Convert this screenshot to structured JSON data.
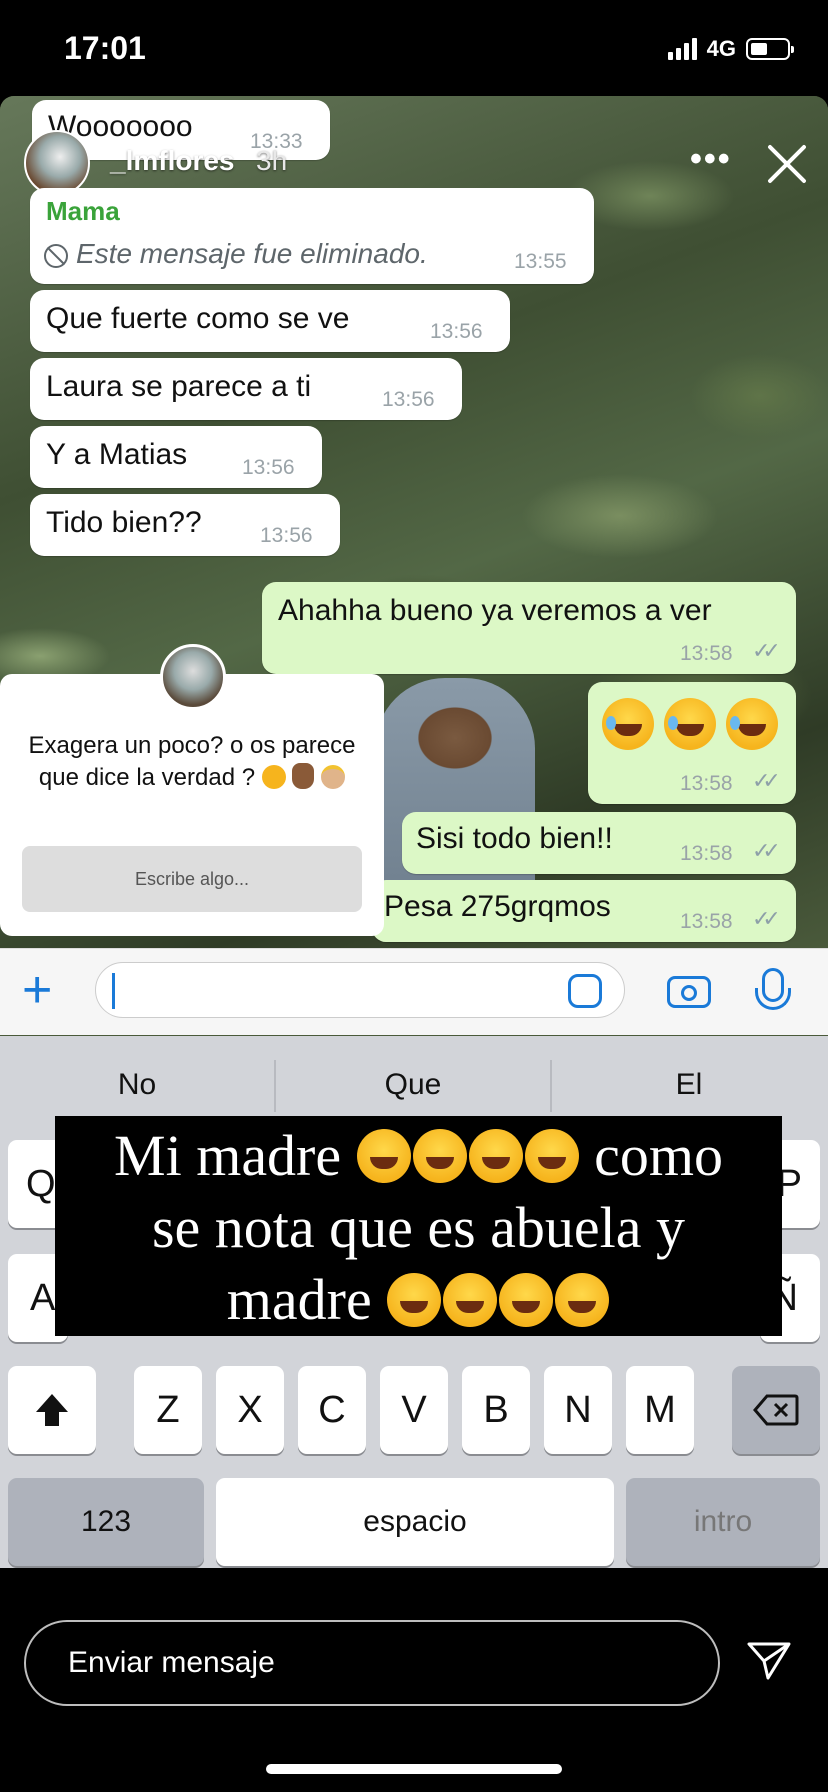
{
  "status_bar": {
    "time": "17:01",
    "network": "4G"
  },
  "story": {
    "username": "_lmflores",
    "time_ago": "3h",
    "more": "•••"
  },
  "chat": {
    "top_partial": {
      "text": "Wooooooo",
      "time": "13:33"
    },
    "messages": [
      {
        "sender": "Mama",
        "deleted_text": "Este mensaje fue eliminado.",
        "time": "13:55"
      },
      {
        "text": "Que fuerte como se ve",
        "time": "13:56"
      },
      {
        "text": "Laura se parece a ti",
        "time": "13:56"
      },
      {
        "text": "Y a Matias",
        "time": "13:56"
      },
      {
        "text": "Tido bien??",
        "time": "13:56"
      },
      {
        "text": "Ahahha bueno ya veremos a ver",
        "time": "13:58"
      },
      {
        "text": "",
        "time": "13:58",
        "emojis": [
          "rolling-on-floor-laughing",
          "rolling-on-floor-laughing",
          "rolling-on-floor-laughing"
        ]
      },
      {
        "text": "Sisi todo bien!!",
        "time": "13:58"
      },
      {
        "text": "Pesa 275grqmos",
        "time": "13:58"
      }
    ]
  },
  "question_sticker": {
    "question": "Exagera un poco? o os parece que dice la verdad ?",
    "question_emojis": [
      "rolling-on-floor-laughing",
      "victory-hand",
      "princess"
    ],
    "placeholder": "Escribe algo..."
  },
  "keyboard": {
    "suggestions": [
      "No",
      "Que",
      "El"
    ],
    "row3": [
      "Z",
      "X",
      "C",
      "V",
      "B",
      "N",
      "M"
    ],
    "left_visible": [
      "Q",
      "A"
    ],
    "right_visible": [
      "P",
      "Ñ"
    ],
    "numbers_key": "123",
    "space_key": "espacio",
    "return_key": "intro"
  },
  "caption": {
    "line1_text": "Mi madre",
    "line1_end": "como",
    "line2": "se nota que es abuela y",
    "line3_text": "madre",
    "emoji": "rolling-on-floor-laughing"
  },
  "reply": {
    "placeholder": "Enviar mensaje"
  },
  "colors": {
    "accent": "#1a7ad8",
    "outgoing": "#dcf8c6",
    "sender_name": "#3aa33a"
  }
}
